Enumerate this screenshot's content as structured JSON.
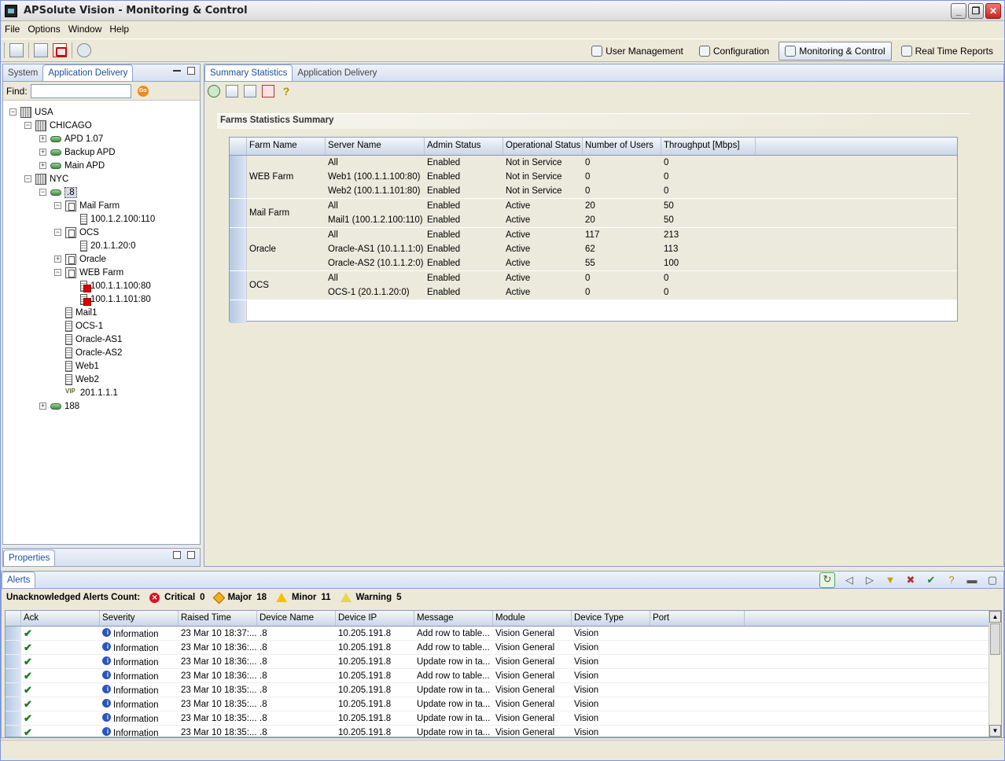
{
  "window": {
    "title": "APSolute Vision - Monitoring & Control"
  },
  "menu": [
    "File",
    "Options",
    "Window",
    "Help"
  ],
  "perspectives": [
    {
      "label": "User Management",
      "icon": "user-icon",
      "active": false
    },
    {
      "label": "Configuration",
      "icon": "gear-icon",
      "active": false
    },
    {
      "label": "Monitoring & Control",
      "icon": "monitor-icon",
      "active": true
    },
    {
      "label": "Real Time Reports",
      "icon": "chart-icon",
      "active": false
    }
  ],
  "left_panel": {
    "tabs": [
      "System",
      "Application Delivery"
    ],
    "active_tab": "Application Delivery",
    "find_label": "Find:",
    "find_value": "",
    "go_label": "Go"
  },
  "tree": [
    {
      "label": "USA",
      "icon": "building-icon",
      "toggle": "−",
      "depth": 0
    },
    {
      "label": "CHICAGO",
      "icon": "building-icon",
      "toggle": "−",
      "depth": 1
    },
    {
      "label": "APD 1.07",
      "icon": "device-icon",
      "toggle": "+",
      "depth": 2
    },
    {
      "label": "Backup APD",
      "icon": "device-icon",
      "toggle": "+",
      "depth": 2
    },
    {
      "label": "Main APD",
      "icon": "device-icon",
      "toggle": "+",
      "depth": 2
    },
    {
      "label": "NYC",
      "icon": "building-icon",
      "toggle": "−",
      "depth": 1
    },
    {
      "label": ".8",
      "icon": "device-icon",
      "toggle": "−",
      "depth": 2,
      "selected": true
    },
    {
      "label": "Mail Farm",
      "icon": "farm-icon",
      "toggle": "−",
      "depth": 3
    },
    {
      "label": "100.1.2.100:110",
      "icon": "server-icon",
      "toggle": "",
      "depth": 4
    },
    {
      "label": "OCS",
      "icon": "farm-icon",
      "toggle": "−",
      "depth": 3
    },
    {
      "label": "20.1.1.20:0",
      "icon": "server-icon",
      "toggle": "",
      "depth": 4
    },
    {
      "label": "Oracle",
      "icon": "farm-icon",
      "toggle": "+",
      "depth": 3
    },
    {
      "label": "WEB Farm",
      "icon": "farm-down-icon",
      "toggle": "−",
      "depth": 3
    },
    {
      "label": "100.1.1.100:80",
      "icon": "server-down-icon",
      "toggle": "",
      "depth": 4
    },
    {
      "label": "100.1.1.101:80",
      "icon": "server-down-icon",
      "toggle": "",
      "depth": 4
    },
    {
      "label": "Mail1",
      "icon": "server-icon",
      "toggle": "",
      "depth": 3
    },
    {
      "label": "OCS-1",
      "icon": "server-icon",
      "toggle": "",
      "depth": 3
    },
    {
      "label": "Oracle-AS1",
      "icon": "server-icon",
      "toggle": "",
      "depth": 3
    },
    {
      "label": "Oracle-AS2",
      "icon": "server-icon",
      "toggle": "",
      "depth": 3
    },
    {
      "label": "Web1",
      "icon": "server-icon",
      "toggle": "",
      "depth": 3
    },
    {
      "label": "Web2",
      "icon": "server-icon",
      "toggle": "",
      "depth": 3
    },
    {
      "label": "201.1.1.1",
      "icon": "vip-icon",
      "vip_text": "VIP",
      "toggle": "",
      "depth": 3
    },
    {
      "label": "188",
      "icon": "device-icon",
      "toggle": "+",
      "depth": 2
    }
  ],
  "properties_tab": "Properties",
  "editor": {
    "tabs": [
      "Summary Statistics",
      "Application Delivery"
    ],
    "active_tab": "Summary Statistics",
    "section_title": "Farms Statistics Summary",
    "columns": [
      "Farm Name",
      "Server Name",
      "Admin Status",
      "Operational Status",
      "Number of Users",
      "Throughput [Mbps]"
    ],
    "groups": [
      {
        "farm": "WEB Farm",
        "rows": [
          [
            "All",
            "Enabled",
            "Not in Service",
            "0",
            "0"
          ],
          [
            "Web1 (100.1.1.100:80)",
            "Enabled",
            "Not in Service",
            "0",
            "0"
          ],
          [
            "Web2 (100.1.1.101:80)",
            "Enabled",
            "Not in Service",
            "0",
            "0"
          ]
        ]
      },
      {
        "farm": "Mail Farm",
        "rows": [
          [
            "All",
            "Enabled",
            "Active",
            "20",
            "50"
          ],
          [
            "Mail1 (100.1.2.100:110)",
            "Enabled",
            "Active",
            "20",
            "50"
          ]
        ]
      },
      {
        "farm": "Oracle",
        "rows": [
          [
            "All",
            "Enabled",
            "Active",
            "117",
            "213"
          ],
          [
            "Oracle-AS1 (10.1.1.1:0)",
            "Enabled",
            "Active",
            "62",
            "113"
          ],
          [
            "Oracle-AS2 (10.1.1.2:0)",
            "Enabled",
            "Active",
            "55",
            "100"
          ]
        ]
      },
      {
        "farm": "OCS",
        "rows": [
          [
            "All",
            "Enabled",
            "Active",
            "0",
            "0"
          ],
          [
            "OCS-1 (20.1.1.20:0)",
            "Enabled",
            "Active",
            "0",
            "0"
          ]
        ]
      }
    ]
  },
  "alerts": {
    "tab": "Alerts",
    "count_label": "Unacknowledged Alerts Count:",
    "counts": [
      {
        "label": "Critical",
        "value": "0",
        "kind": "crit"
      },
      {
        "label": "Major",
        "value": "18",
        "kind": "maj"
      },
      {
        "label": "Minor",
        "value": "11",
        "kind": "min"
      },
      {
        "label": "Warning",
        "value": "5",
        "kind": "warn"
      }
    ],
    "columns": [
      "Ack",
      "Severity",
      "Raised Time",
      "Device Name",
      "Device IP",
      "Message",
      "Module",
      "Device Type",
      "Port"
    ],
    "rows": [
      [
        "Information",
        "23 Mar 10 18:37:...",
        ".8",
        "10.205.191.8",
        "Add row to table...",
        "Vision General",
        "Vision",
        ""
      ],
      [
        "Information",
        "23 Mar 10 18:36:...",
        ".8",
        "10.205.191.8",
        "Add row to table...",
        "Vision General",
        "Vision",
        ""
      ],
      [
        "Information",
        "23 Mar 10 18:36:...",
        ".8",
        "10.205.191.8",
        "Update row in ta...",
        "Vision General",
        "Vision",
        ""
      ],
      [
        "Information",
        "23 Mar 10 18:36:...",
        ".8",
        "10.205.191.8",
        "Add row to table...",
        "Vision General",
        "Vision",
        ""
      ],
      [
        "Information",
        "23 Mar 10 18:35:...",
        ".8",
        "10.205.191.8",
        "Update row in ta...",
        "Vision General",
        "Vision",
        ""
      ],
      [
        "Information",
        "23 Mar 10 18:35:...",
        ".8",
        "10.205.191.8",
        "Update row in ta...",
        "Vision General",
        "Vision",
        ""
      ],
      [
        "Information",
        "23 Mar 10 18:35:...",
        ".8",
        "10.205.191.8",
        "Update row in ta...",
        "Vision General",
        "Vision",
        ""
      ],
      [
        "Information",
        "23 Mar 10 18:35:...",
        ".8",
        "10.205.191.8",
        "Update row in ta...",
        "Vision General",
        "Vision",
        ""
      ]
    ]
  }
}
